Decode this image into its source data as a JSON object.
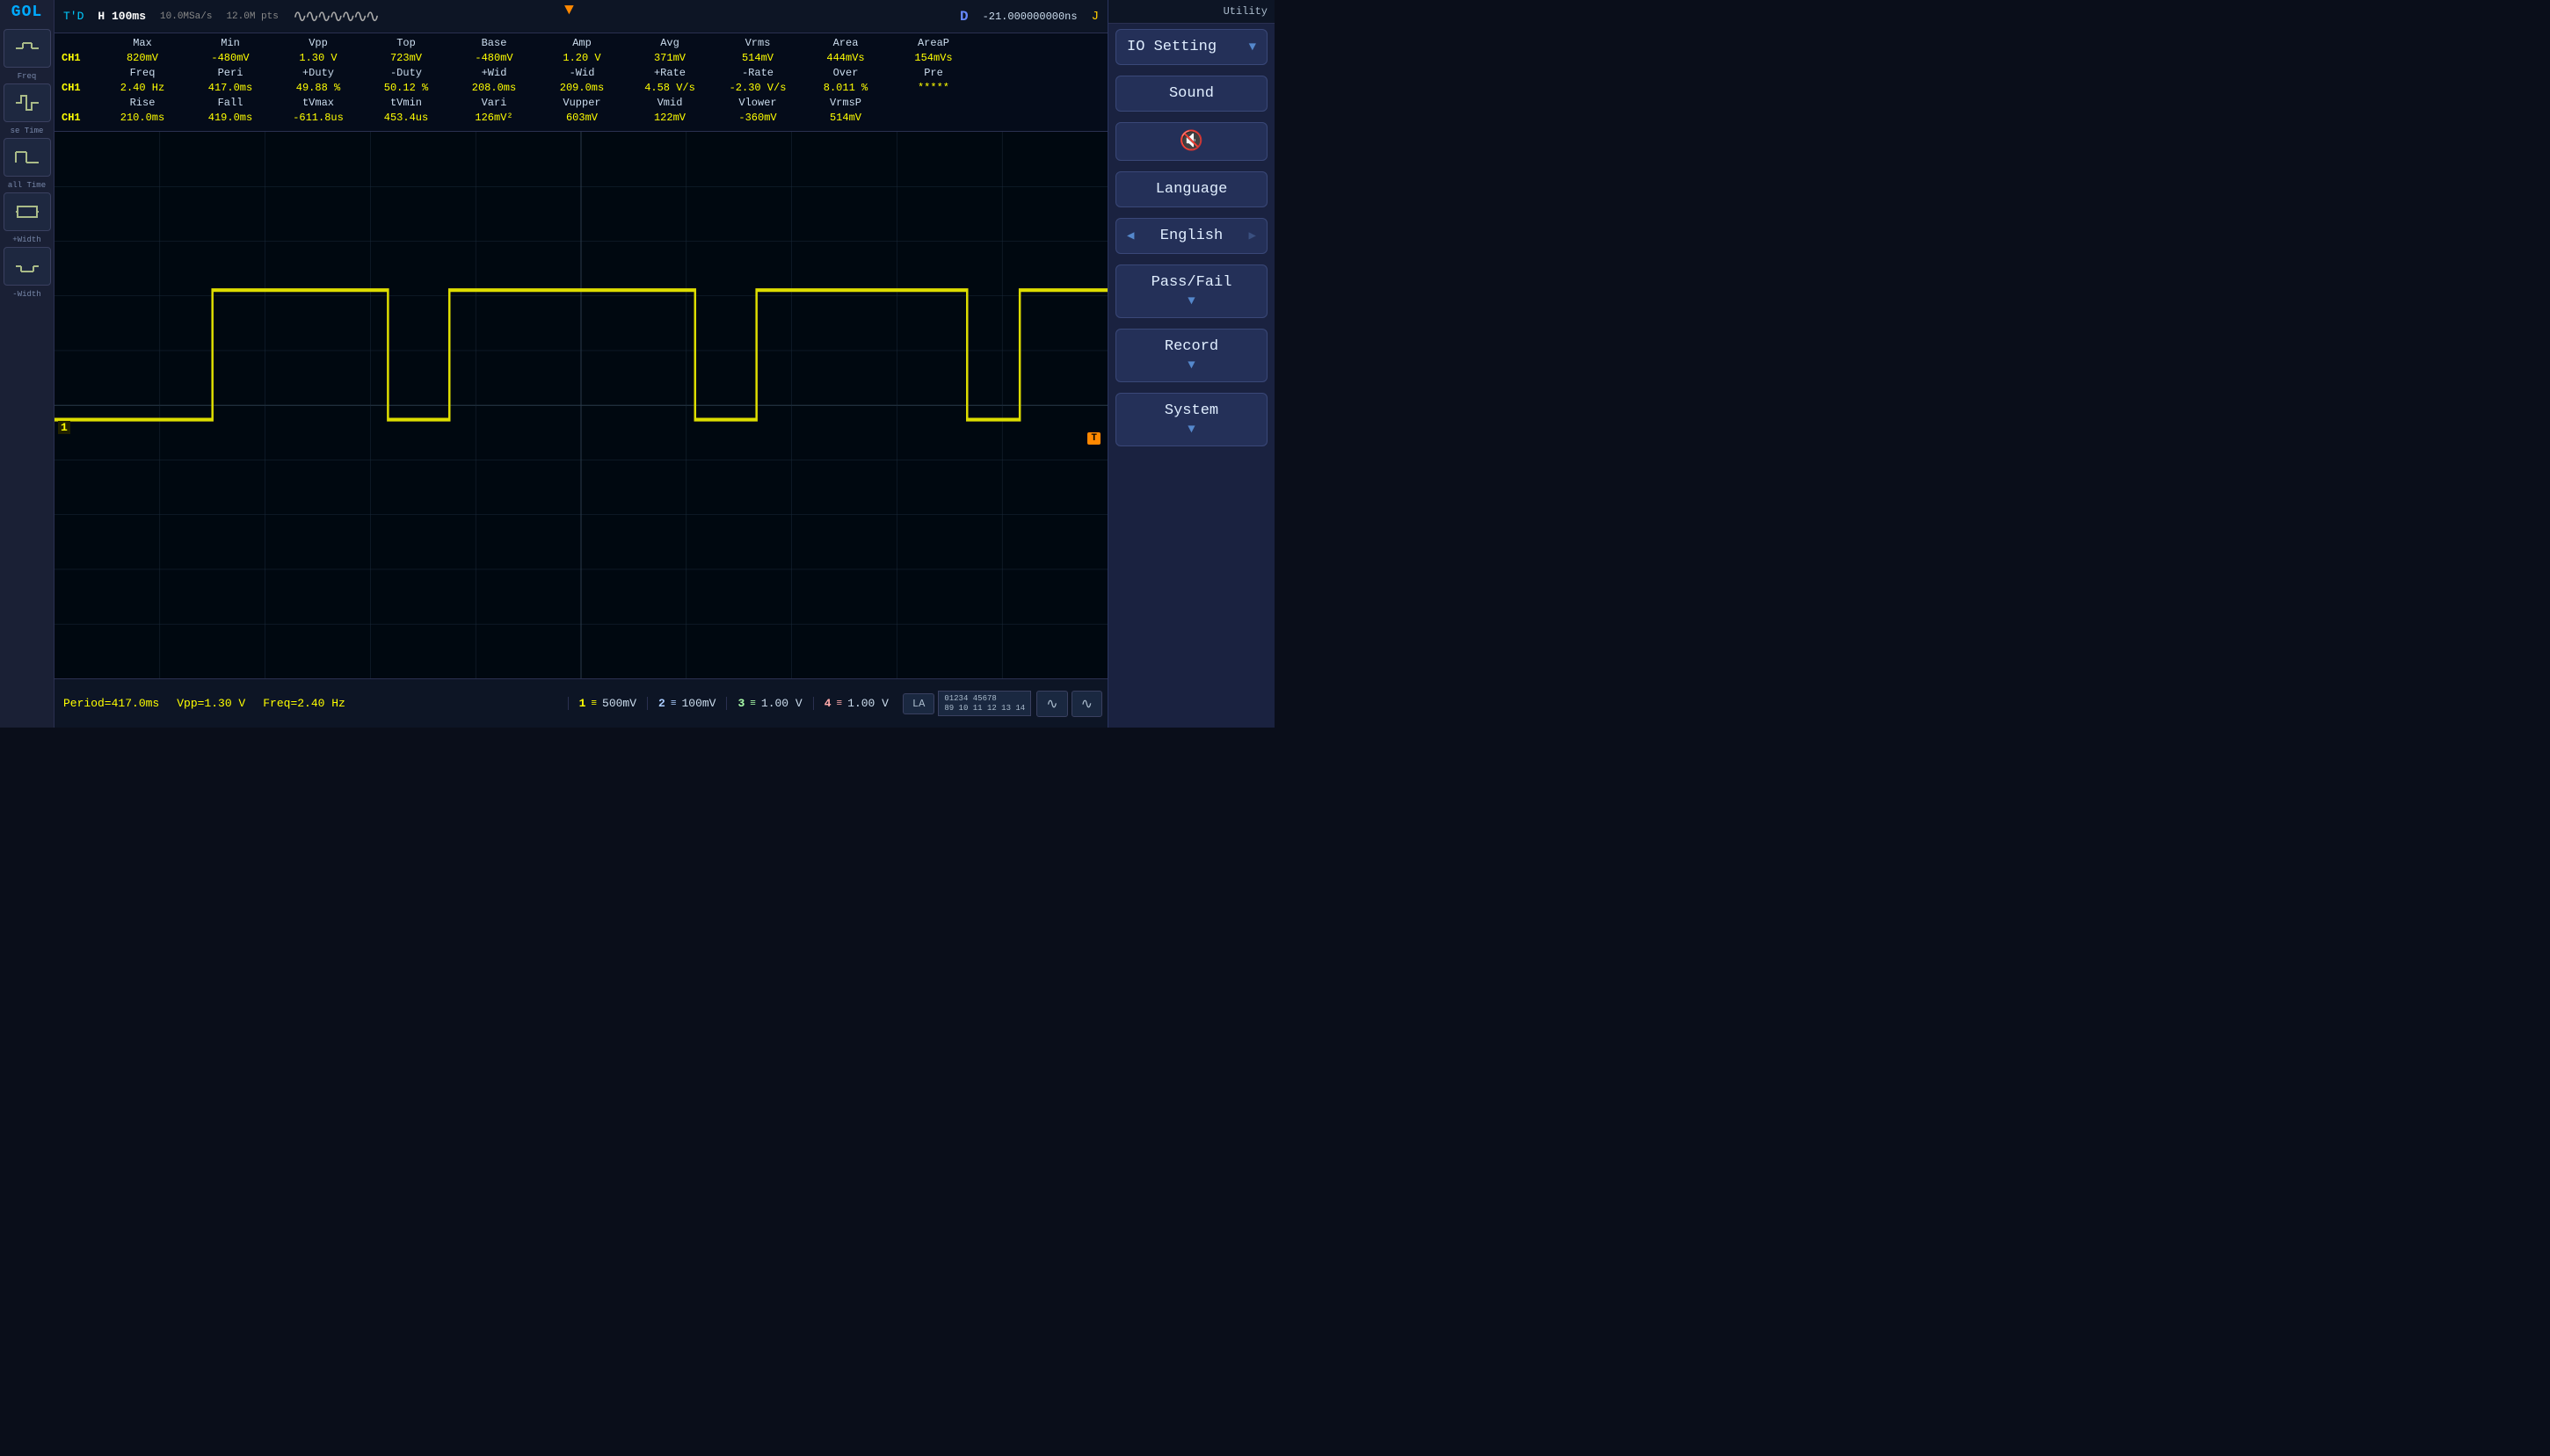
{
  "brand": "GOL",
  "header": {
    "td_label": "T'D",
    "time_div": "H  100ms",
    "sample_rate": "10.0MSa/s",
    "pts": "12.0M pts",
    "d_marker": "D",
    "time_offset": "-21.000000000ns",
    "j_marker": "J"
  },
  "measurements": {
    "row1_headers": [
      "Max",
      "Min",
      "Vpp",
      "Top",
      "Base",
      "Amp",
      "Avg",
      "Vrms",
      "Area",
      "AreaP"
    ],
    "row1_ch": "CH1",
    "row1_vals": [
      "820mV",
      "-480mV",
      "1.30 V",
      "723mV",
      "-480mV",
      "1.20 V",
      "371mV",
      "514mV",
      "444mVs",
      "154mVs"
    ],
    "row2_headers": [
      "Freq",
      "Peri",
      "+Duty",
      "-Duty",
      "+Wid",
      "-Wid",
      "+Rate",
      "-Rate",
      "Over",
      "Pre"
    ],
    "row2_ch": "CH1",
    "row2_vals": [
      "2.40 Hz",
      "417.0ms",
      "49.88 %",
      "50.12 %",
      "208.0ms",
      "209.0ms",
      "4.58 V/s",
      "-2.30 V/s",
      "8.011 %",
      "*****"
    ],
    "row3_headers": [
      "Rise",
      "Fall",
      "tVmax",
      "tVmin",
      "Vari",
      "Vupper",
      "Vmid",
      "Vlower",
      "VrmsP"
    ],
    "row3_ch": "CH1",
    "row3_vals": [
      "210.0ms",
      "419.0ms",
      "-611.8us",
      "453.4us",
      "126mV²",
      "603mV",
      "122mV",
      "-360mV",
      "514mV"
    ]
  },
  "bottom": {
    "period": "Period=417.0ms",
    "vpp": "Vpp=1.30 V",
    "freq": "Freq=2.40 Hz",
    "ch1_scale": "500mV",
    "ch2_scale": "100mV",
    "ch3_scale": "1.00 V",
    "ch4_scale": "1.00 V",
    "la_label": "LA"
  },
  "right_panel": {
    "utility_label": "Utility",
    "io_setting_label": "IO Setting",
    "sound_label": "Sound",
    "language_label": "Language",
    "english_label": "English",
    "passfail_label": "Pass/Fail",
    "record_label": "Record",
    "system_label": "System"
  },
  "sidebar": {
    "freq_label": "Freq",
    "rise_time_label": "se Time",
    "all_time_label": "all Time",
    "width_label": "+Width",
    "neg_width_label": "-Width"
  }
}
